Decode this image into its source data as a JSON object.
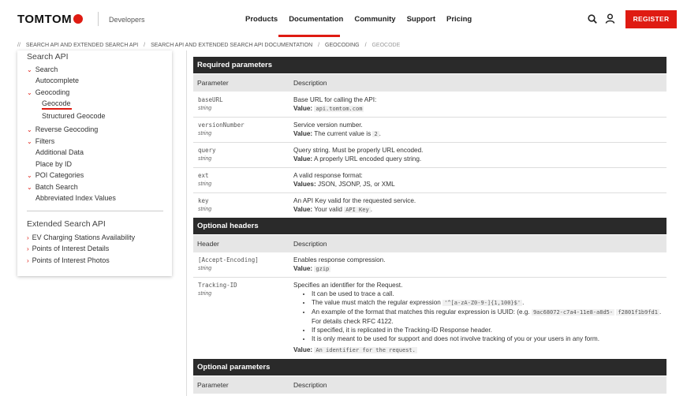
{
  "header": {
    "logo": "TOMTOM",
    "subtitle": "Developers",
    "nav": [
      "Products",
      "Documentation",
      "Community",
      "Support",
      "Pricing"
    ],
    "register": "REGISTER"
  },
  "breadcrumb": [
    "SEARCH API AND EXTENDED SEARCH API",
    "SEARCH API AND EXTENDED SEARCH API DOCUMENTATION",
    "GEOCODING",
    "GEOCODE"
  ],
  "sidebar": {
    "title": "Search API",
    "items": [
      "Search",
      "Autocomplete",
      "Geocoding",
      "Geocode",
      "Structured Geocode",
      "Reverse Geocoding",
      "Filters",
      "Additional Data",
      "Place by ID",
      "POI Categories",
      "Batch Search",
      "Abbreviated Index Values"
    ],
    "ext_title": "Extended Search API",
    "ext_items": [
      "EV Charging Stations Availability",
      "Points of Interest Details",
      "Points of Interest Photos"
    ]
  },
  "required": {
    "title": "Required parameters",
    "col1": "Parameter",
    "col2": "Description",
    "rows": [
      {
        "name": "baseURL",
        "type": "string",
        "desc": "Base URL for calling the API:",
        "vlabel": "Value:",
        "vcode": "api.tomtom.com",
        "vtail": ""
      },
      {
        "name": "versionNumber",
        "type": "string",
        "desc": "Service version number.",
        "vlabel": "Value:",
        "vpre": "The current value is ",
        "vcode": "2",
        "vtail": "."
      },
      {
        "name": "query",
        "type": "string",
        "desc": "Query string. Must be properly URL encoded.",
        "vlabel": "Value:",
        "vpre": "A properly URL encoded query string."
      },
      {
        "name": "ext",
        "type": "string",
        "desc": "A valid response format:",
        "vlabel": "Values:",
        "vpre": "JSON, JSONP, JS, or XML"
      },
      {
        "name": "key",
        "type": "string",
        "desc": "An API Key valid for the requested service.",
        "vlabel": "Value:",
        "vpre": "Your valid ",
        "vcode": "API Key",
        "vtail": "."
      }
    ]
  },
  "optional_headers": {
    "title": "Optional headers",
    "col1": "Header",
    "col2": "Description",
    "rows": [
      {
        "name": "[Accept-Encoding]",
        "type": "string",
        "desc": "Enables response compression.",
        "vlabel": "Value:",
        "vcode": "gzip"
      },
      {
        "name": "Tracking-ID",
        "type": "string",
        "desc": "Specifies an identifier for the Request.",
        "bullets": [
          "It can be used to trace a call.",
          "The value must match the regular expression",
          "An example of the format that matches this regular expression is UUID: (e.g.",
          "f2801f1b9fd1",
          ". For details check RFC 4122.",
          "If specified, it is replicated in the Tracking-ID Response header.",
          "It is only meant to be used for support and does not involve tracking of you or your users in any form."
        ],
        "regex": "'^[a-zA-Z0-9-]{1,100}$'",
        "uuid": "9ac68072-c7a4-11e8-a8d5-",
        "vlabel": "Value:",
        "vcode": "An identifier for the request."
      }
    ]
  },
  "optional_params": {
    "title": "Optional parameters",
    "col1": "Parameter",
    "col2": "Description"
  },
  "colors": {
    "accent": "#df1b12",
    "table_head": "#2a2a2a",
    "col_head": "#e6e6e6"
  }
}
